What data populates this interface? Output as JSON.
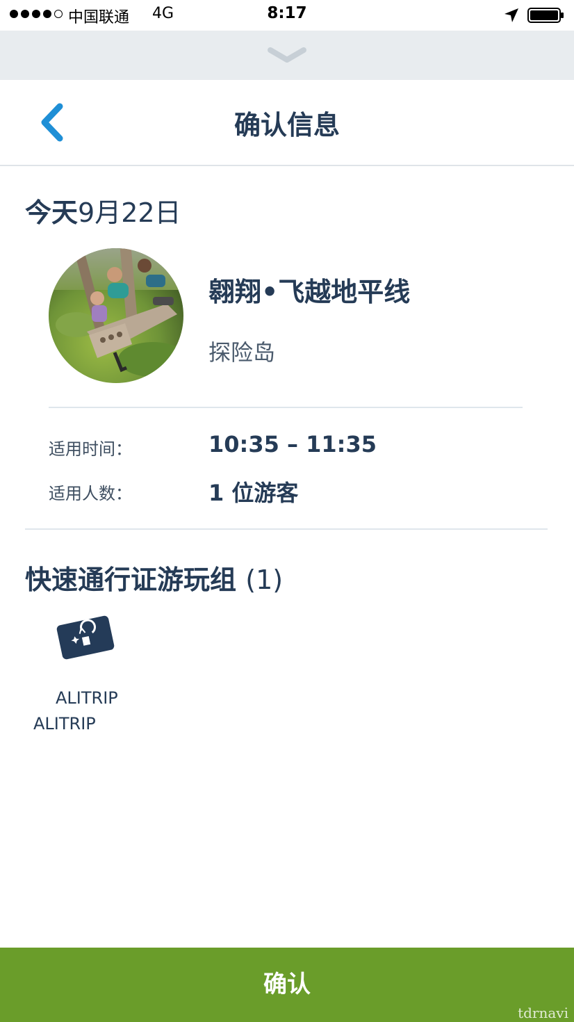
{
  "status_bar": {
    "carrier": "中国联通",
    "network": "4G",
    "time": "8:17",
    "signal_bars": 4,
    "signal_max": 5,
    "icons": [
      "location-arrow-icon",
      "battery-icon"
    ]
  },
  "pull_bar": {
    "icon": "chevron-down-icon"
  },
  "header": {
    "title": "确认信息",
    "back_icon": "chevron-left-icon"
  },
  "date": {
    "prefix": "今天",
    "value": "9月22日"
  },
  "attraction": {
    "name": "翱翔•飞越地平线",
    "land": "探险岛"
  },
  "details": {
    "time_label": "适用时间：",
    "time_value": "10:35 – 11:35",
    "party_label": "适用人数：",
    "party_value": "1 位游客"
  },
  "group": {
    "title": "快速通行证游玩组",
    "count": "(1)",
    "guests": [
      {
        "icon": "park-ticket-card-icon",
        "name_line1": "ALITRIP",
        "name_line2": "ALITRIP"
      }
    ]
  },
  "confirm": {
    "label": "确认"
  },
  "watermark": "tdrnavi",
  "colors": {
    "navy": "#253b56",
    "accent_blue": "#1f8fd6",
    "confirm_green": "#6a9d2a",
    "pull_bar_gray": "#e8ecef"
  }
}
